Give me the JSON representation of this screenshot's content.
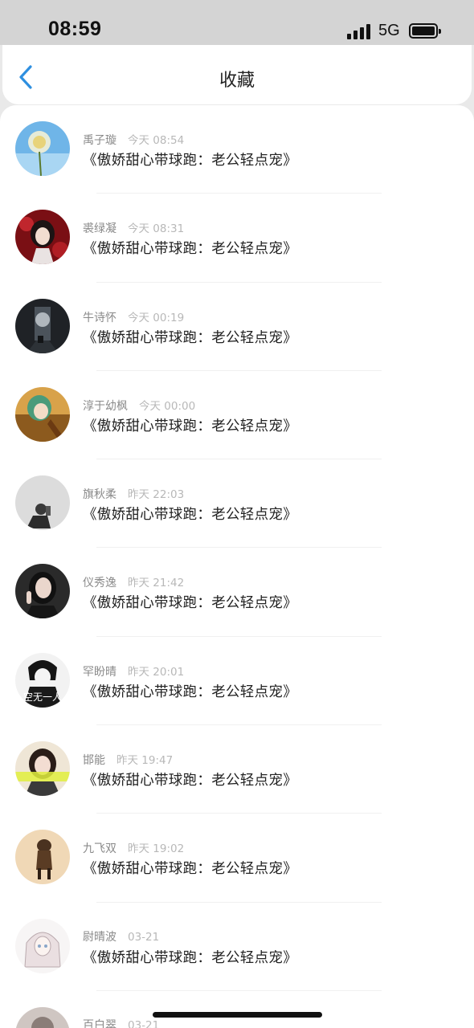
{
  "status_bar": {
    "time": "08:59",
    "network": "5G"
  },
  "header": {
    "title": "收藏"
  },
  "items": [
    {
      "name": "禹子璇",
      "time": "今天 08:54",
      "title": "《傲娇甜心带球跑：老公轻点宠》",
      "avatar": "dandelion-avatar"
    },
    {
      "name": "裘绿凝",
      "time": "今天 08:31",
      "title": "《傲娇甜心带球跑：老公轻点宠》",
      "avatar": "anime-girl-red-avatar"
    },
    {
      "name": "牛诗怀",
      "time": "今天 00:19",
      "title": "《傲娇甜心带球跑：老公轻点宠》",
      "avatar": "dark-corridor-avatar"
    },
    {
      "name": "淳于幼枫",
      "time": "今天 00:00",
      "title": "《傲娇甜心带球跑：老公轻点宠》",
      "avatar": "green-hair-anime-avatar"
    },
    {
      "name": "旗秋柔",
      "time": "昨天 22:03",
      "title": "《傲娇甜心带球跑：老公轻点宠》",
      "avatar": "grey-figure-avatar"
    },
    {
      "name": "仪秀逸",
      "time": "昨天 21:42",
      "title": "《傲娇甜心带球跑：老公轻点宠》",
      "avatar": "girl-peace-sign-avatar"
    },
    {
      "name": "罕盼晴",
      "time": "昨天 20:01",
      "title": "《傲娇甜心带球跑：老公轻点宠》",
      "avatar": "bw-anime-boy-avatar",
      "avatar_text": "空无一人"
    },
    {
      "name": "邯能",
      "time": "昨天 19:47",
      "title": "《傲娇甜心带球跑：老公轻点宠》",
      "avatar": "girl-portrait-avatar"
    },
    {
      "name": "九飞双",
      "time": "昨天 19:02",
      "title": "《傲娇甜心带球跑：老公轻点宠》",
      "avatar": "dog-avatar"
    },
    {
      "name": "尉晴波",
      "time": "03-21",
      "title": "《傲娇甜心带球跑：老公轻点宠》",
      "avatar": "sketch-anime-girl-avatar"
    },
    {
      "name": "百白翠",
      "time": "03-21",
      "title": "",
      "avatar": "partial-avatar"
    }
  ]
}
